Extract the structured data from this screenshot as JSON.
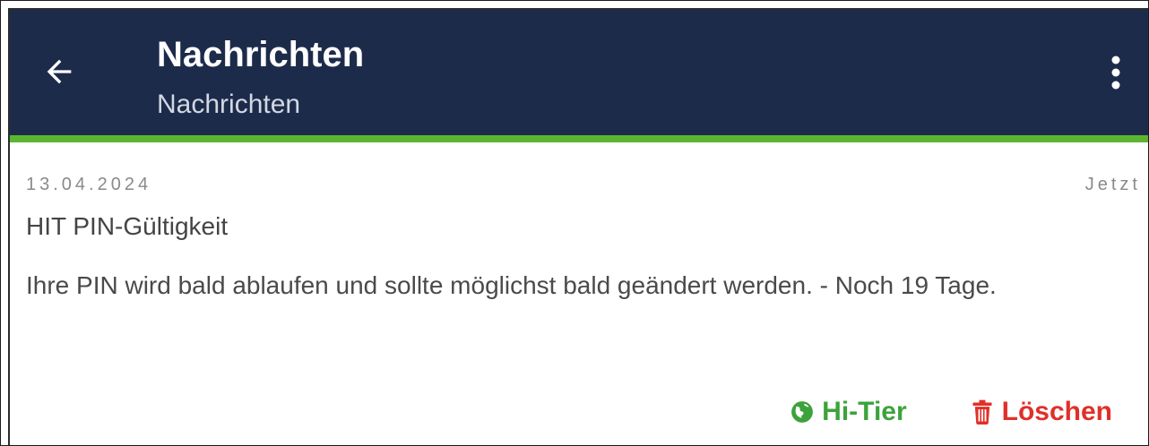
{
  "header": {
    "title": "Nachrichten",
    "subtitle": "Nachrichten",
    "background_color": "#1d2b4b",
    "accent_color": "#5cb531",
    "back_icon": "arrow-left-icon",
    "menu_icon": "more-vert-icon"
  },
  "message": {
    "date": "13.04.2024",
    "time": "Jetzt",
    "title": "HIT PIN-Gültigkeit",
    "body": "Ihre PIN wird bald ablaufen und sollte möglichst bald geändert werden. - Noch 19 Tage."
  },
  "actions": {
    "hitier": {
      "label": "Hi-Tier",
      "icon": "globe-icon",
      "color": "#3ca33c"
    },
    "delete": {
      "label": "Löschen",
      "icon": "trash-icon",
      "color": "#e0302a"
    }
  }
}
